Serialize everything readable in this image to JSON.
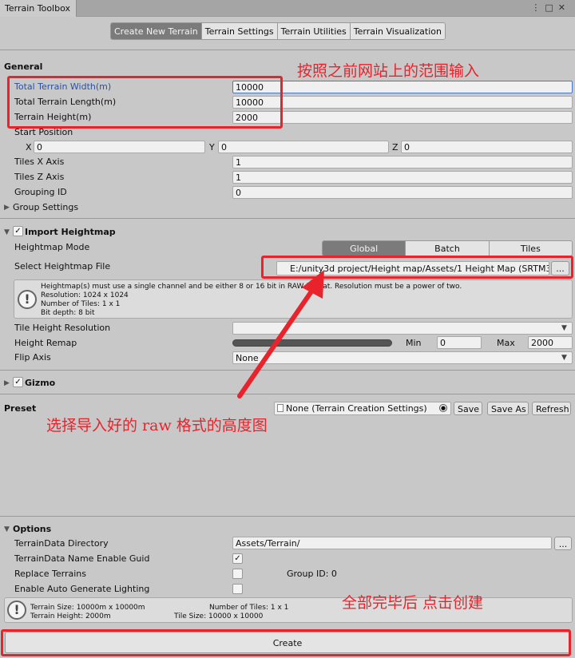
{
  "window": {
    "tab_title": "Terrain Toolbox",
    "menu_icon": "kebab-menu-icon",
    "maximize_icon": "maximize-icon",
    "close_icon": "close-icon"
  },
  "toolbar": {
    "tabs": [
      "Create New Terrain",
      "Terrain Settings",
      "Terrain Utilities",
      "Terrain Visualization"
    ],
    "active": 0
  },
  "general": {
    "title": "General",
    "width_label": "Total Terrain Width(m)",
    "width_value": "10000",
    "length_label": "Total Terrain Length(m)",
    "length_value": "10000",
    "height_label": "Terrain Height(m)",
    "height_value": "2000",
    "start_label": "Start Position",
    "x_label": "X",
    "x_value": "0",
    "y_label": "Y",
    "y_value": "0",
    "z_label": "Z",
    "z_value": "0",
    "tilesx_label": "Tiles X Axis",
    "tilesx_value": "1",
    "tilesz_label": "Tiles Z Axis",
    "tilesz_value": "1",
    "group_label": "Grouping ID",
    "group_value": "0",
    "group_settings": "Group Settings"
  },
  "heightmap": {
    "title": "Import Heightmap",
    "checked": "✓",
    "mode_label": "Heightmap Mode",
    "modes": [
      "Global",
      "Batch",
      "Tiles"
    ],
    "file_label": "Select Heightmap File",
    "file_value": "E:/unity3d project/Height map/Assets/1 Height Map (SRTM3 v",
    "browse": "...",
    "info_line1": "Heightmap(s) must use a single channel and be either 8 or 16 bit in RAW format. Resolution must be a power of two.",
    "info_line2": "Resolution: 1024 x 1024",
    "info_line3": "Number of Tiles: 1 x 1",
    "info_line4": "Bit depth: 8 bit",
    "tile_res_label": "Tile Height Resolution",
    "remap_label": "Height Remap",
    "min_label": "Min",
    "min_value": "0",
    "max_label": "Max",
    "max_value": "2000",
    "flip_label": "Flip Axis",
    "flip_value": "None"
  },
  "gizmo": {
    "title": "Gizmo",
    "checked": "✓"
  },
  "preset": {
    "title": "Preset",
    "value": "None (Terrain Creation Settings)",
    "save": "Save",
    "save_as": "Save As",
    "refresh": "Refresh"
  },
  "options": {
    "title": "Options",
    "dir_label": "TerrainData Directory",
    "dir_value": "Assets/Terrain/",
    "dir_browse": "...",
    "guid_label": "TerrainData Name Enable Guid",
    "guid_checked": "✓",
    "replace_label": "Replace Terrains",
    "group_id_text": "Group ID: 0",
    "lighting_label": "Enable Auto Generate Lighting",
    "summary_size": "Terrain Size: 10000m x 10000m",
    "summary_height": "Terrain Height: 2000m",
    "summary_tiles": "Number of Tiles: 1 x 1",
    "summary_tile_size": "Tile Size: 10000 x 10000"
  },
  "create_button": "Create",
  "annotations": {
    "note1": "按照之前网站上的范围输入",
    "note2": "选择导入好的 raw 格式的高度图",
    "note3": "全部完毕后 点击创建",
    "color": "#e8232c"
  }
}
